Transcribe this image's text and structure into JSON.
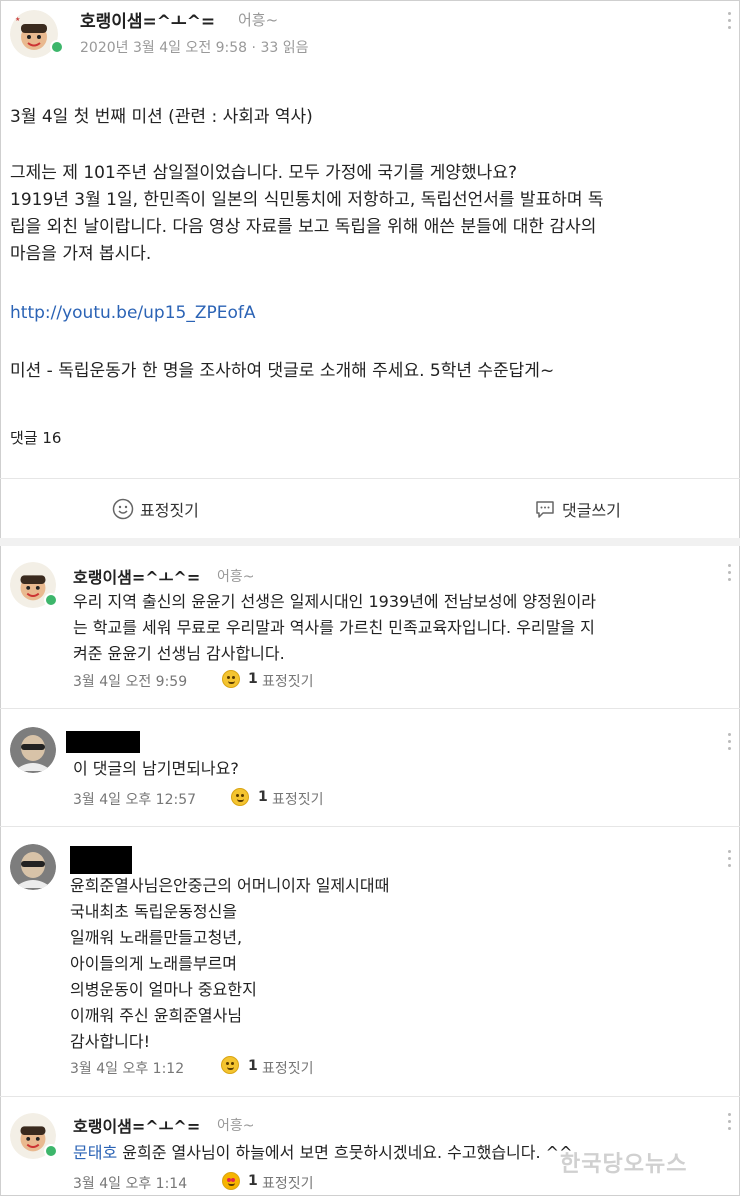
{
  "post": {
    "author": "호랭이샘=^ㅗ^=",
    "nickname": "어흥~",
    "date": "2020년 3월 4일 오전 9:58",
    "dot": "·",
    "reads": "33 읽음",
    "lines": [
      "3월 4일 첫 번째 미션 (관련 : 사회과 역사)",
      "그제는 제 101주년 삼일절이었습니다. 모두 가정에 국기를 게양했나요?",
      "1919년 3월 1일, 한민족이 일본의 식민통치에 저항하고, 독립선언서를 발표하며 독",
      "립을 외친 날이랍니다. 다음 영상 자료를 보고 독립을 위해 애쓴 분들에 대한 감사의",
      "마음을 가져 봅시다.",
      "미션 - 독립운동가 한 명을 조사하여 댓글로 소개해 주세요. 5학년 수준답게~"
    ],
    "link": "http://youtu.be/up15_ZPEofA",
    "comment_count": "댓글 16"
  },
  "actions": {
    "react_label": "표정짓기",
    "comment_label": "댓글쓰기"
  },
  "comments": [
    {
      "author": "호랭이샘=^ㅗ^=",
      "nickname": "어흥~",
      "lines": [
        "우리 지역 출신의 윤윤기 선생은 일제시대인 1939년에 전남보성에 양정원이라",
        "는 학교를 세워 무료로 우리말과 역사를 가르친 민족교육자입니다. 우리말을 지",
        "켜준 윤윤기 선생님 감사합니다."
      ],
      "date": "3월 4일 오전 9:59",
      "reactions": "1",
      "react_label": "표정짓기"
    },
    {
      "lines": [
        "이 댓글의 남기면되나요?"
      ],
      "date": "3월 4일 오후 12:57",
      "reactions": "1",
      "react_label": "표정짓기"
    },
    {
      "lines": [
        "윤희준열사님은안중근의 어머니이자 일제시대때",
        "국내최초 독립운동정신을",
        "일깨워 노래를만들고청년,",
        "아이들의게 노래를부르며",
        "의병운동이 얼마나 중요한지",
        "이깨워 주신 윤희준열사님",
        "감사합니다!"
      ],
      "date": "3월 4일 오후 1:12",
      "reactions": "1",
      "react_label": "표정짓기"
    },
    {
      "author": "호랭이샘=^ㅗ^=",
      "nickname": "어흥~",
      "mention": "문태호",
      "text": "윤희준 열사님이 하늘에서 보면 흐뭇하시겠네요. 수고했습니다. ^^",
      "date": "3월 4일 오후 1:14",
      "reactions": "1",
      "react_label": "표정짓기"
    }
  ],
  "watermark": "한국당오뉴스",
  "colors": {
    "link": "#2b63b5",
    "online": "#3db66b",
    "meta": "#999999"
  },
  "icons": [
    "smile-icon",
    "comment-icon",
    "more-icon",
    "emoji-reaction-icon"
  ]
}
